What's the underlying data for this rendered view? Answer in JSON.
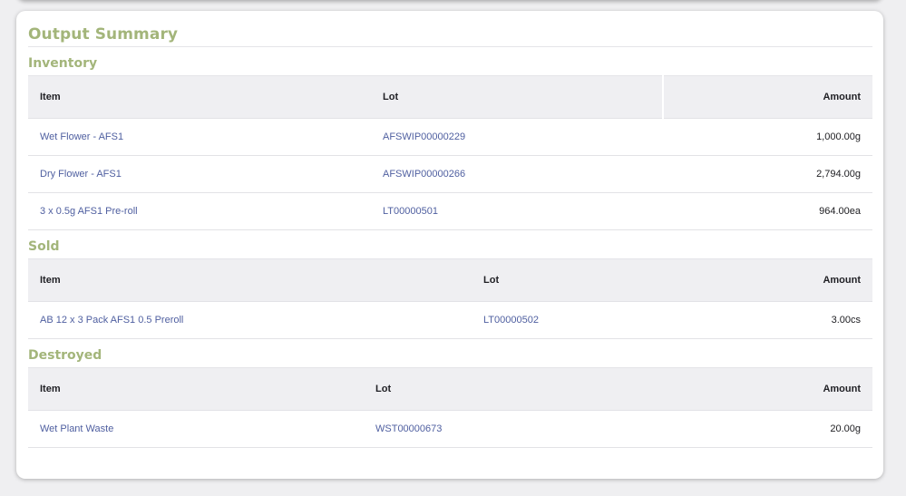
{
  "page": {
    "title": "Output Summary"
  },
  "colors": {
    "heading_green": "#a3b57a",
    "link_blue": "#4f5fa0",
    "header_gray": "#efeff2"
  },
  "sections": {
    "inventory": {
      "title": "Inventory",
      "columns": {
        "item": "Item",
        "lot": "Lot",
        "amount": "Amount"
      },
      "rows": [
        {
          "item": "Wet Flower - AFS1",
          "lot": "AFSWIP00000229",
          "amount": "1,000.00g"
        },
        {
          "item": "Dry Flower - AFS1",
          "lot": "AFSWIP00000266",
          "amount": "2,794.00g"
        },
        {
          "item": "3 x 0.5g AFS1 Pre-roll",
          "lot": "LT00000501",
          "amount": "964.00ea"
        }
      ]
    },
    "sold": {
      "title": "Sold",
      "columns": {
        "item": "Item",
        "lot": "Lot",
        "amount": "Amount"
      },
      "rows": [
        {
          "item": "AB 12 x 3 Pack AFS1 0.5 Preroll",
          "lot": "LT00000502",
          "amount": "3.00cs"
        }
      ]
    },
    "destroyed": {
      "title": "Destroyed",
      "columns": {
        "item": "Item",
        "lot": "Lot",
        "amount": "Amount"
      },
      "rows": [
        {
          "item": "Wet Plant Waste",
          "lot": "WST00000673",
          "amount": "20.00g"
        }
      ]
    }
  }
}
